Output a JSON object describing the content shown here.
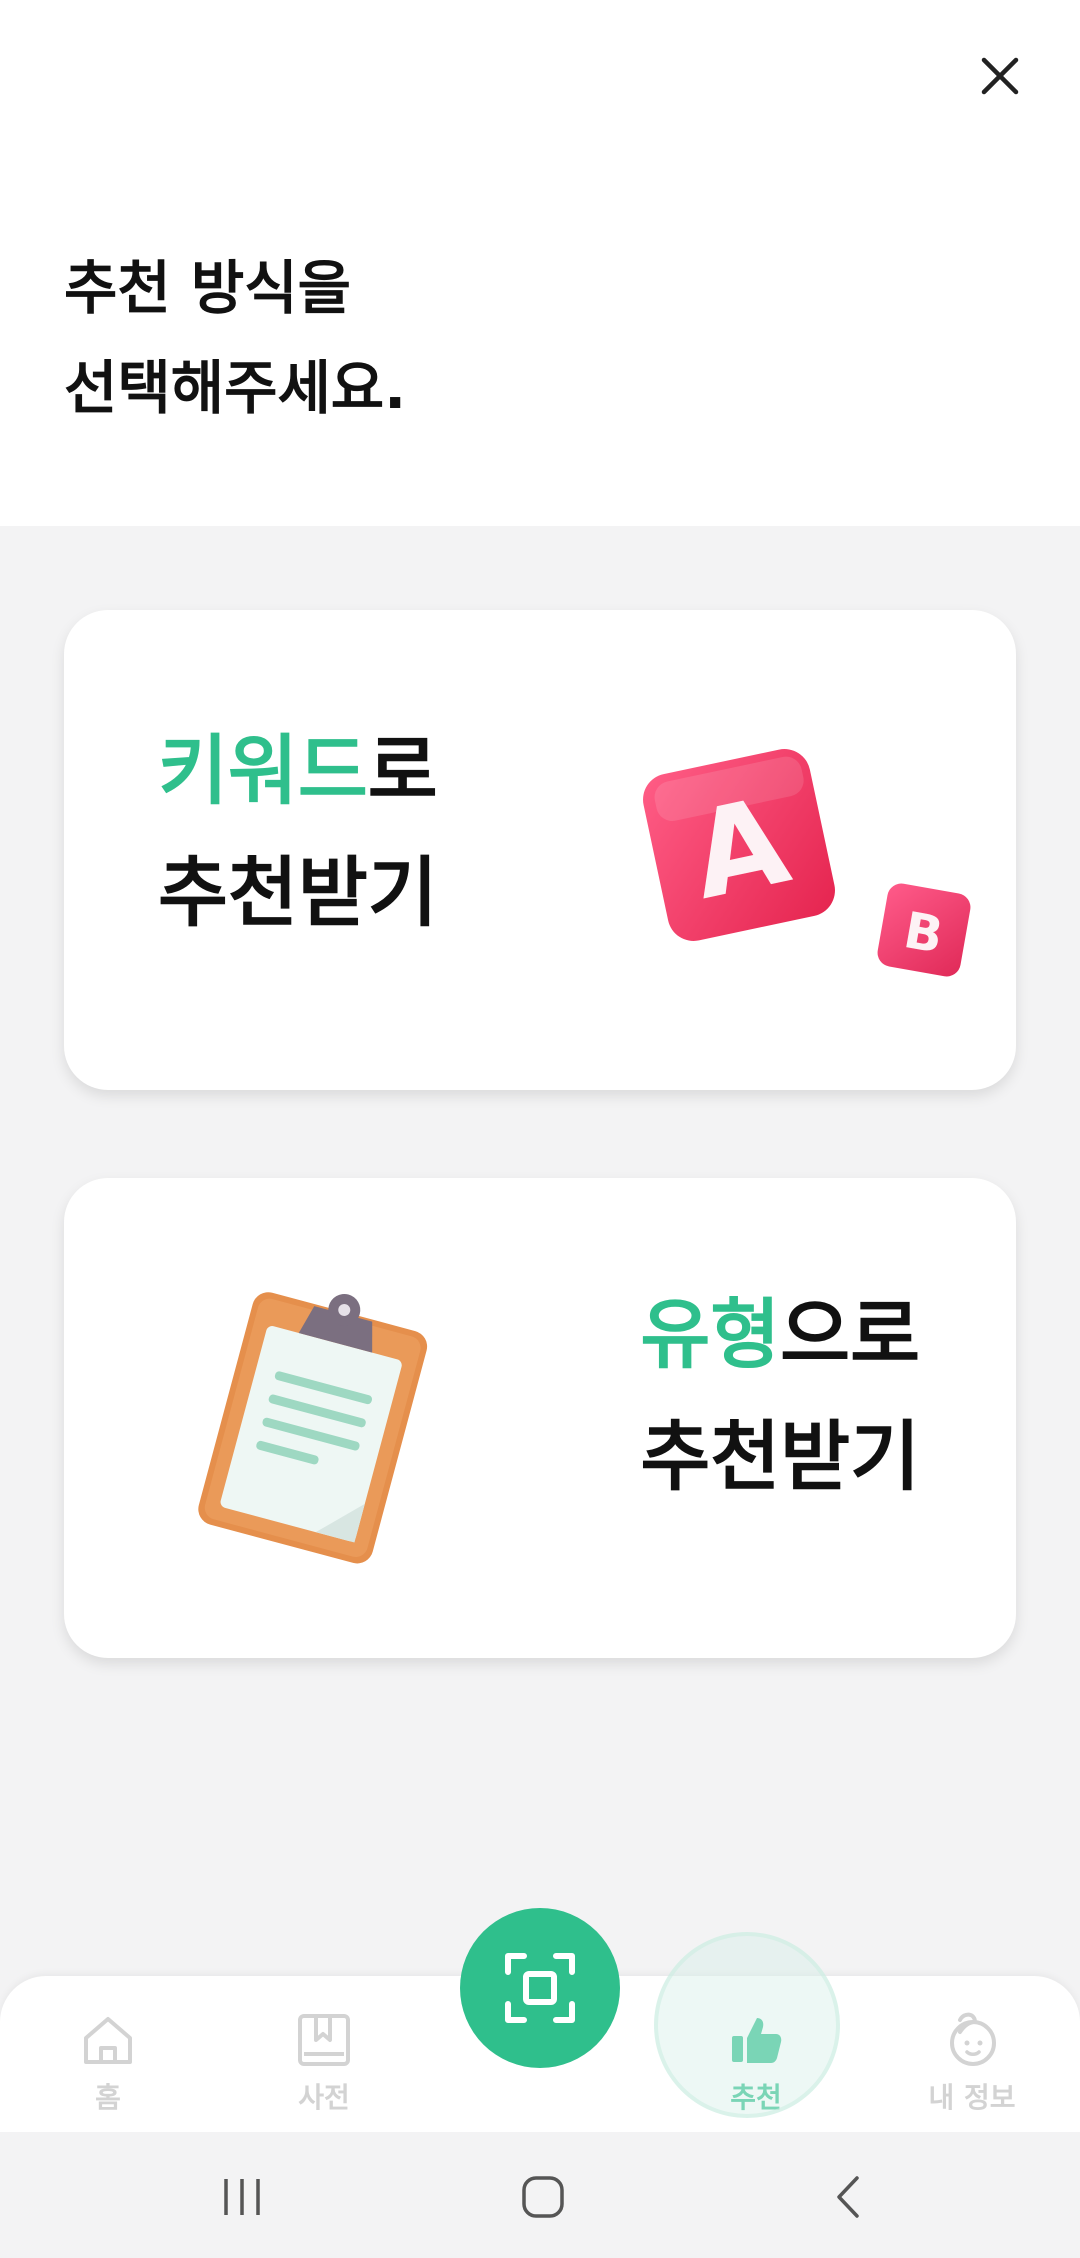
{
  "header": {
    "title_line1": "추천 방식을",
    "title_line2": "선택해주세요.",
    "close_icon": "close-icon"
  },
  "cards": [
    {
      "accent_text": "키워드",
      "text_suffix": "로",
      "line2": "추천받기",
      "illustration": "ab-blocks-icon"
    },
    {
      "accent_text": "유형",
      "text_suffix": "으로",
      "line2": "추천받기",
      "illustration": "clipboard-icon"
    }
  ],
  "bottom_nav": {
    "items": [
      {
        "label": "홈",
        "icon": "home-icon",
        "active": false
      },
      {
        "label": "사전",
        "icon": "book-icon",
        "active": false
      },
      {
        "label": "추천",
        "icon": "thumbs-up-icon",
        "active": true
      },
      {
        "label": "내 정보",
        "icon": "profile-icon",
        "active": false
      }
    ],
    "center_button_icon": "scan-icon"
  },
  "system_nav": [
    "recent-apps-icon",
    "home-circle-icon",
    "back-icon"
  ],
  "colors": {
    "accent": "#2fbf8c",
    "background": "#f3f3f4",
    "card": "#ffffff",
    "inactive": "#d3d3d3"
  }
}
